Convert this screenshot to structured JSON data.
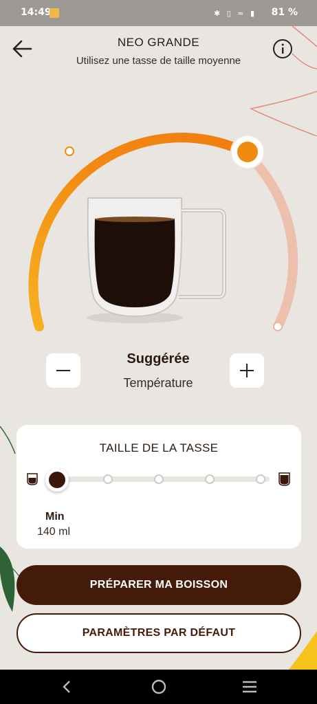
{
  "status_bar": {
    "time": "14:49",
    "battery": "81 %",
    "icons": [
      "bluetooth-icon",
      "vibrate-icon",
      "wifi-icon",
      "signal-icon",
      "battery-icon"
    ]
  },
  "header": {
    "title": "NEO GRANDE",
    "subtitle": "Utilisez une tasse de taille moyenne"
  },
  "temperature": {
    "value": "Suggérée",
    "label": "Température",
    "level": 0.72
  },
  "cup_size": {
    "title": "TAILLE DE LA TASSE",
    "selected_label": "Min",
    "selected_value": "140 ml",
    "steps": 5,
    "selected_index": 0
  },
  "actions": {
    "primary": "PRÉPARER MA BOISSON",
    "secondary": "PARAMÈTRES PAR DÉFAUT"
  },
  "colors": {
    "accent": "#f08a10",
    "arc_start": "#f7b020",
    "arc_end": "#eab7a4",
    "brand": "#431b08",
    "background": "#e9e5e1"
  }
}
